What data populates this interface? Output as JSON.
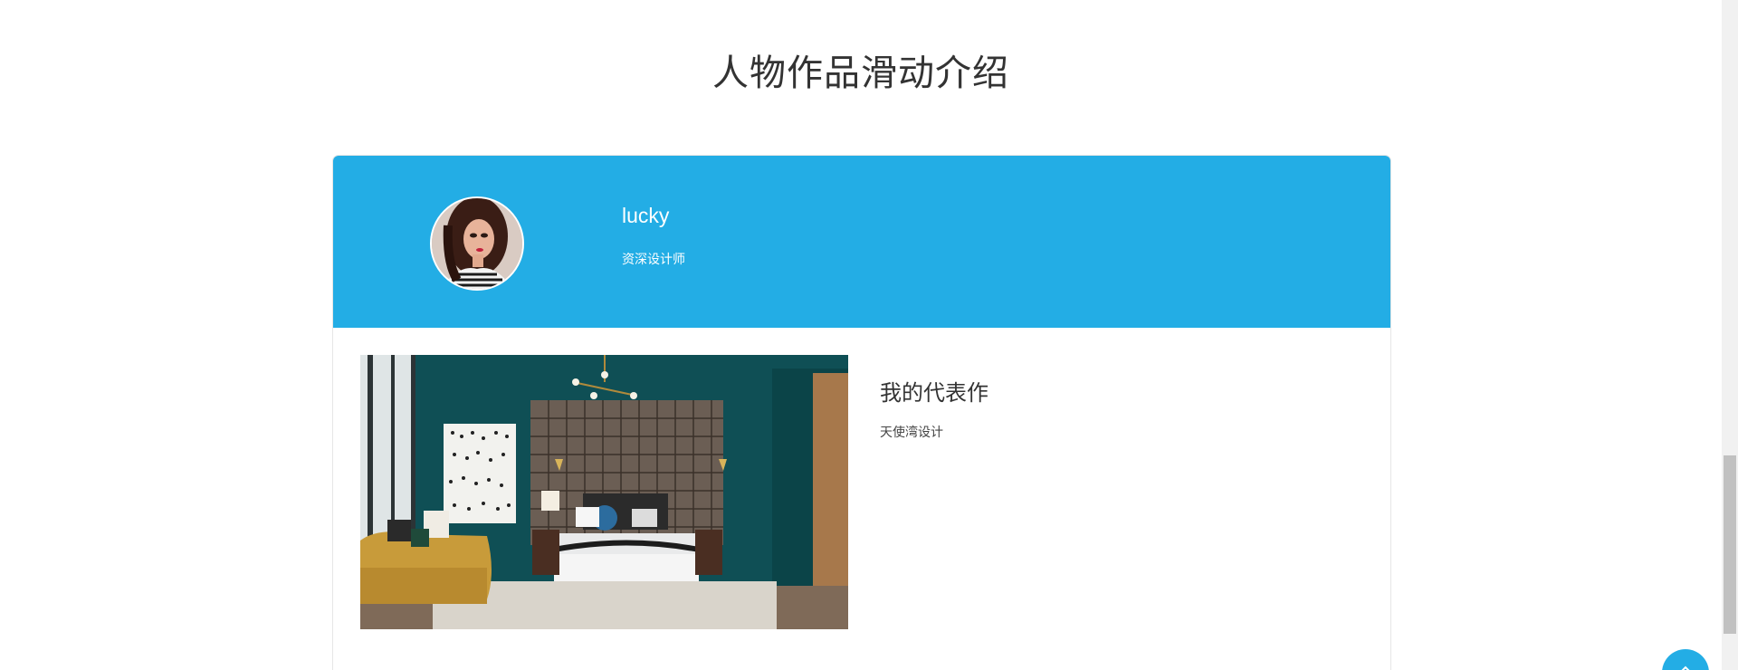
{
  "section": {
    "title": "人物作品滑动介绍"
  },
  "profile": {
    "name": "lucky",
    "role": "资深设计师",
    "avatar_icon": "woman-portrait"
  },
  "work": {
    "title": "我的代表作",
    "description": "天使湾设计",
    "image_icon": "bedroom-interior-photo"
  },
  "colors": {
    "accent": "#23ade5",
    "text_dark": "#333333",
    "scroll_track": "#f1f1f1",
    "scroll_thumb": "#c1c1c1"
  },
  "floating_button": {
    "icon": "chevron-up-icon"
  }
}
